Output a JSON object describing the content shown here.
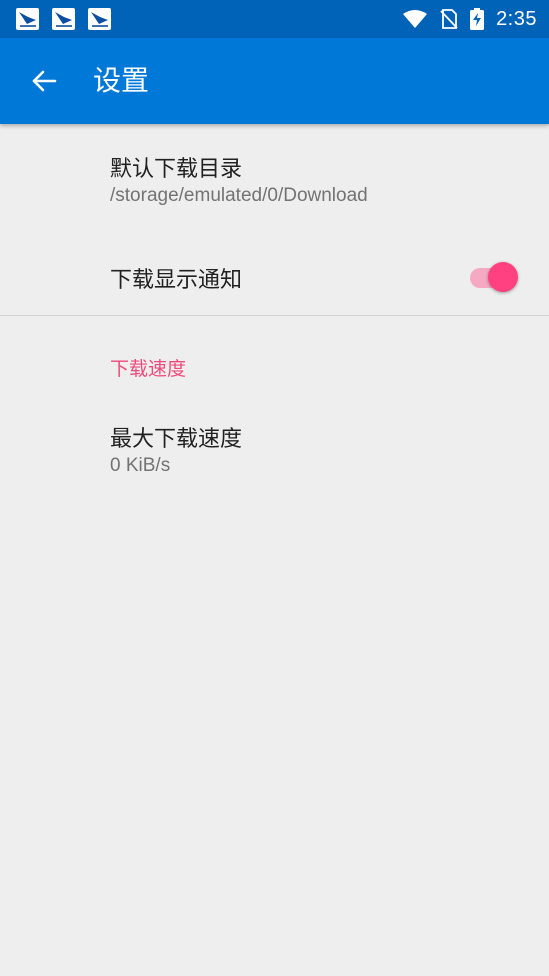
{
  "status_bar": {
    "time": "2:35",
    "notification_icons": [
      "app-notification-icon",
      "app-notification-icon",
      "app-notification-icon"
    ],
    "system_icons": [
      "wifi-icon",
      "no-sim-icon",
      "battery-charging-icon"
    ]
  },
  "app_bar": {
    "title": "设置",
    "back_icon": "arrow-back-icon",
    "background_color": "#0078d7"
  },
  "preferences": {
    "download_dir": {
      "title": "默认下载目录",
      "summary": "/storage/emulated/0/Download"
    },
    "download_notification": {
      "title": "下载显示通知",
      "switch_on": true,
      "accent_color": "#ff4081"
    },
    "speed_category": {
      "label": "下载速度",
      "color": "#ee4a7e"
    },
    "max_speed": {
      "title": "最大下载速度",
      "summary": "0 KiB/s"
    }
  }
}
